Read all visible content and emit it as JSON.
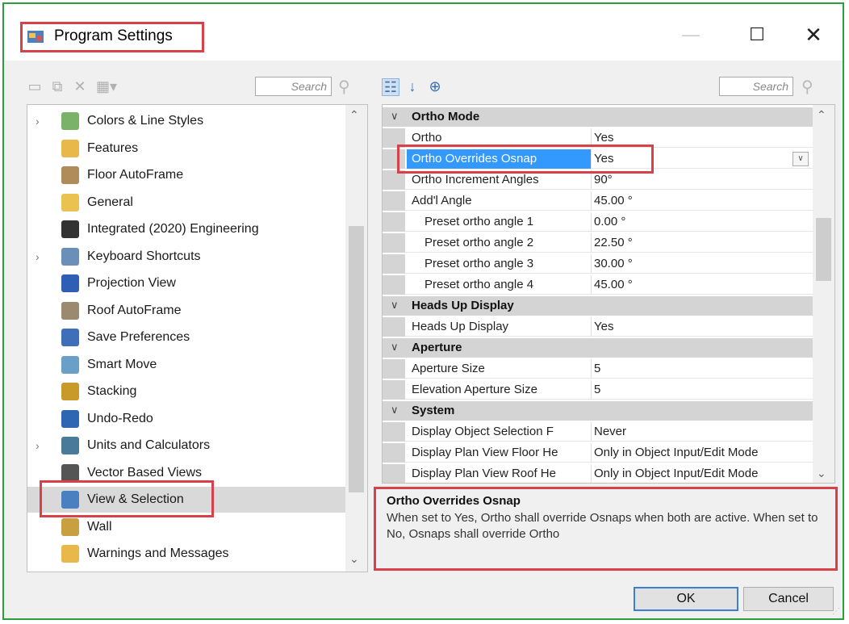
{
  "window": {
    "title": "Program Settings",
    "minimize": "—",
    "maximize": "☐",
    "close": "✕"
  },
  "left_toolbar": {
    "search_placeholder": "Search"
  },
  "tree": {
    "items": [
      {
        "label": "Colors & Line Styles",
        "expandable": true,
        "icon": "palette-icon",
        "color": "#7bb26a"
      },
      {
        "label": "Features",
        "expandable": false,
        "icon": "folder-icon",
        "color": "#e8b84a"
      },
      {
        "label": "Floor AutoFrame",
        "expandable": false,
        "icon": "floor-frame-icon",
        "color": "#b08c5a"
      },
      {
        "label": "General",
        "expandable": false,
        "icon": "general-icon",
        "color": "#e9c24f"
      },
      {
        "label": "Integrated (2020) Engineering",
        "expandable": false,
        "icon": "gear-icon",
        "color": "#333333"
      },
      {
        "label": "Keyboard Shortcuts",
        "expandable": true,
        "icon": "keyboard-icon",
        "color": "#6a8fb8"
      },
      {
        "label": "Projection View",
        "expandable": false,
        "icon": "projection-icon",
        "color": "#2f5fb5"
      },
      {
        "label": "Roof AutoFrame",
        "expandable": false,
        "icon": "roof-frame-icon",
        "color": "#9c8a70"
      },
      {
        "label": "Save Preferences",
        "expandable": false,
        "icon": "save-icon",
        "color": "#3e6fb8"
      },
      {
        "label": "Smart Move",
        "expandable": false,
        "icon": "smart-move-icon",
        "color": "#6aa0c8"
      },
      {
        "label": "Stacking",
        "expandable": false,
        "icon": "stacking-icon",
        "color": "#c89a2a"
      },
      {
        "label": "Undo-Redo",
        "expandable": false,
        "icon": "undo-icon",
        "color": "#2f66b3"
      },
      {
        "label": "Units and Calculators",
        "expandable": true,
        "icon": "calculator-icon",
        "color": "#4a7a9a"
      },
      {
        "label": "Vector Based Views",
        "expandable": false,
        "icon": "vector-view-icon",
        "color": "#555555"
      },
      {
        "label": "View & Selection",
        "expandable": false,
        "icon": "view-selection-icon",
        "color": "#4a7fc0",
        "selected": true
      },
      {
        "label": "Wall",
        "expandable": false,
        "icon": "wall-icon",
        "color": "#c8a040"
      },
      {
        "label": "Warnings and Messages",
        "expandable": false,
        "icon": "warning-folder-icon",
        "color": "#e8b84a"
      }
    ]
  },
  "right_toolbar": {
    "search_placeholder": "Search"
  },
  "properties": {
    "categories": [
      {
        "label": "Ortho Mode",
        "rows": [
          {
            "name": "Ortho",
            "value": "Yes"
          },
          {
            "name": "Ortho Overrides Osnap",
            "value": "Yes",
            "selected": true
          },
          {
            "name": "Ortho Increment Angles",
            "value": "90°"
          },
          {
            "name": "Add'l Angle",
            "value": "45.00 °"
          },
          {
            "name": "Preset ortho angle 1",
            "value": "0.00 °",
            "indent": true
          },
          {
            "name": "Preset ortho angle 2",
            "value": "22.50 °",
            "indent": true
          },
          {
            "name": "Preset ortho angle 3",
            "value": "30.00 °",
            "indent": true
          },
          {
            "name": "Preset ortho angle 4",
            "value": "45.00 °",
            "indent": true
          }
        ]
      },
      {
        "label": "Heads Up Display",
        "rows": [
          {
            "name": "Heads Up Display",
            "value": "Yes"
          }
        ]
      },
      {
        "label": "Aperture",
        "rows": [
          {
            "name": "Aperture Size",
            "value": "5"
          },
          {
            "name": "Elevation Aperture Size",
            "value": "5"
          }
        ]
      },
      {
        "label": "System",
        "rows": [
          {
            "name": "Display Object Selection F",
            "value": "Never"
          },
          {
            "name": "Display Plan View Floor He",
            "value": "Only in Object Input/Edit Mode"
          },
          {
            "name": "Display Plan View Roof He",
            "value": "Only in Object Input/Edit Mode"
          }
        ]
      }
    ]
  },
  "description": {
    "title": "Ortho Overrides Osnap",
    "text": "When set to Yes, Ortho shall override Osnaps when both are active. When set to No, Osnaps shall override Ortho"
  },
  "buttons": {
    "ok": "OK",
    "cancel": "Cancel"
  },
  "colors": {
    "highlight": "#d9414a",
    "selection": "#3399ff",
    "window_border": "#2b9e3b"
  }
}
